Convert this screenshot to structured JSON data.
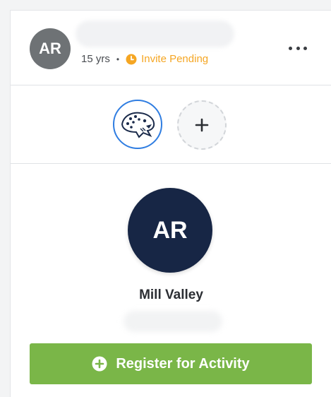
{
  "header": {
    "avatar_initials": "AR",
    "age": "15 yrs",
    "separator": "•",
    "status": "Invite Pending",
    "status_color": "#f5a623"
  },
  "teams": {
    "logo_icon": "jaguar-logo-icon",
    "add_icon": "plus-icon",
    "add_label": "+"
  },
  "profile": {
    "avatar_initials": "AR",
    "team_name": "Mill Valley"
  },
  "actions": {
    "register_label": "Register for Activity",
    "register_icon": "plus-circle-icon",
    "register_color": "#7ab648"
  }
}
